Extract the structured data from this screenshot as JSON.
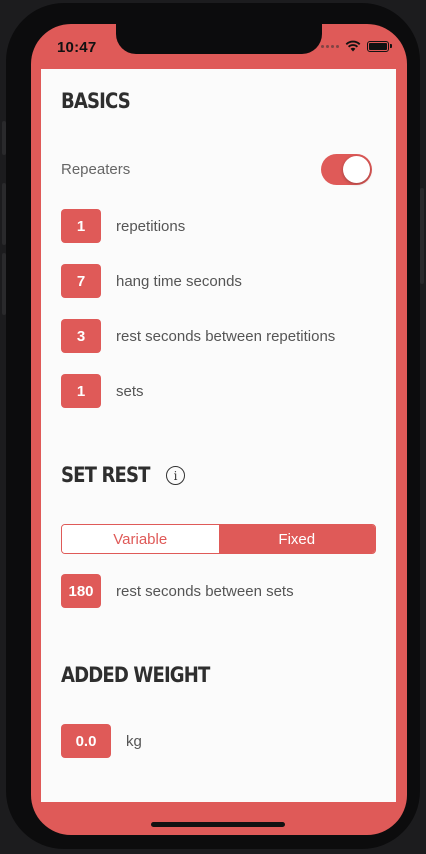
{
  "status_bar": {
    "time": "10:47"
  },
  "basics": {
    "title": "BASICS",
    "repeaters_label": "Repeaters",
    "repeaters_on": true,
    "rows": [
      {
        "value": "1",
        "label": "repetitions"
      },
      {
        "value": "7",
        "label": "hang time seconds"
      },
      {
        "value": "3",
        "label": "rest seconds between repetitions"
      },
      {
        "value": "1",
        "label": "sets"
      }
    ]
  },
  "set_rest": {
    "title": "SET REST",
    "info_icon": "i",
    "segments": [
      "Variable",
      "Fixed"
    ],
    "selected": "Fixed",
    "value": "180",
    "label": "rest seconds between sets"
  },
  "added_weight": {
    "title": "ADDED WEIGHT",
    "value": "0.0",
    "unit": "kg"
  },
  "colors": {
    "accent": "#df5a58",
    "background": "#fbfbfb",
    "text": "#555555"
  }
}
